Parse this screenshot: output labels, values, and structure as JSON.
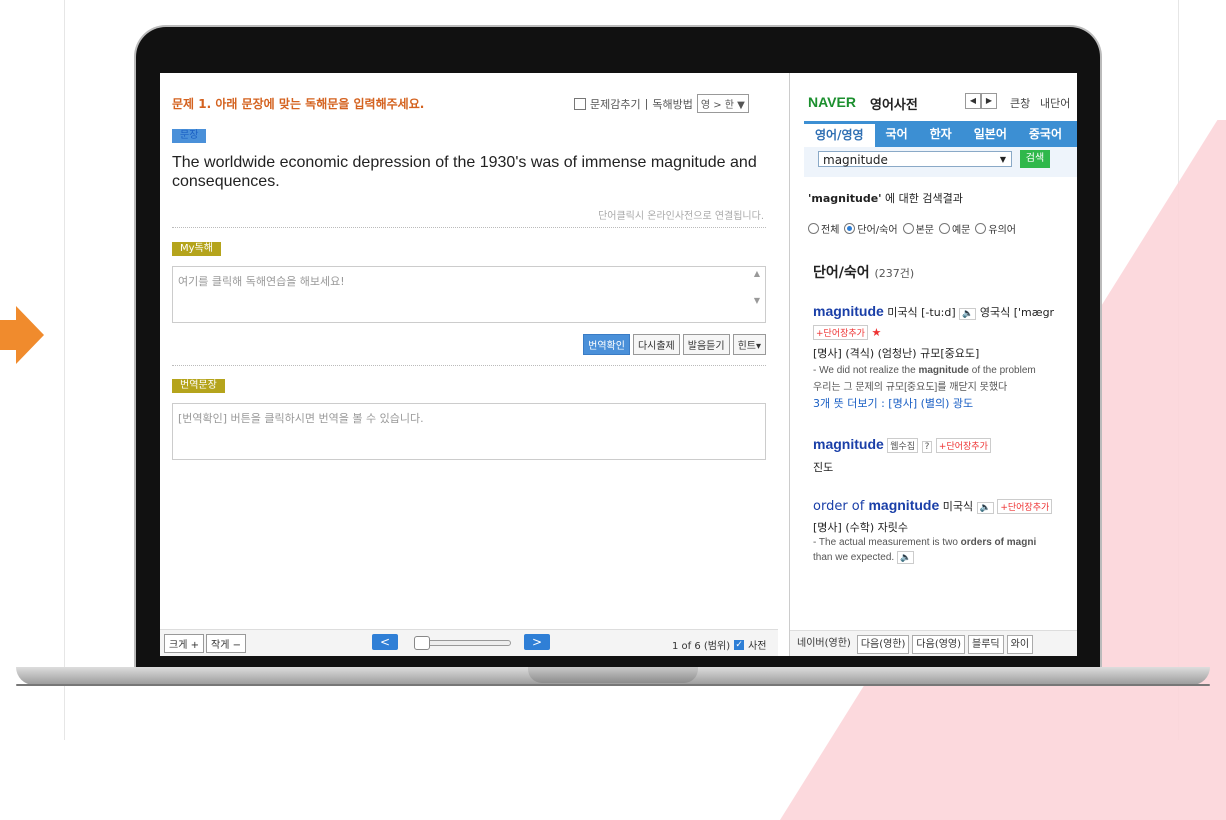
{
  "left": {
    "question": "문제 1. 아래 문장에 맞는 독해문을 입력해주세요.",
    "hide_question": "문제감추기",
    "method_label": "독해방법",
    "method_value": "영 > 한 ▼",
    "sentence_tag": "문장",
    "sentence": "The worldwide economic depression of the 1930's was of immense magnitude and consequences.",
    "click_hint": "단어클릭시 온라인사전으로 연결됩니다.",
    "my_tag": "My독해",
    "my_placeholder": "여기를 클릭해 독해연습을 해보세요!",
    "buttons": [
      "번역확인",
      "다시출제",
      "발음듣기",
      "힌트▾"
    ],
    "trans_tag": "번역문장",
    "trans_placeholder": "[번역확인] 버튼을 클릭하시면 번역을 볼 수 있습니다.",
    "bigger": "크게 +",
    "smaller": "작게 −",
    "prev": "<",
    "next": ">",
    "page_info": "1 of 6 (범위)",
    "dict_label": "사전"
  },
  "right": {
    "logo": "NAVER",
    "title": "영어사전",
    "big_window": "큰창",
    "my_words": "내단어",
    "tabs": [
      "영어/영영",
      "국어",
      "한자",
      "일본어",
      "중국어"
    ],
    "search_value": "magnitude",
    "search_button": "검색",
    "result_term": "'magnitude'",
    "result_suffix": " 에 대한 검색결과",
    "filters": [
      "전체",
      "단어/숙어",
      "본문",
      "예문",
      "유의어"
    ],
    "section": "단어/숙어",
    "section_count": "(237건)",
    "e1_word": "magnitude",
    "e1_us": " 미국식 [-tu:d]",
    "e1_uk": " 영국식 ['mægr",
    "add_word": "+단어장추가",
    "star": "★",
    "e1_pos": "[명사] (격식) ",
    "e1_def": "(엄청난) 규모[중요도]",
    "e1_ex1_pre": "- We did not realize the ",
    "e1_ex1_bold": "magnitude",
    "e1_ex1_post": " of the problem",
    "e1_ex2": "  우리는 그 문제의 규모[중요도]를 깨닫지 못했다",
    "e1_more": "3개 뜻 더보기 : [명사] (별의) 광도",
    "e2_word": "magnitude",
    "e2_badge": "웹수집",
    "e2_q": "?",
    "e2_def": "진도",
    "e3_pre": "order of ",
    "e3_word": "magnitude",
    "e3_us": " 미국식",
    "e3_pos": "[명사] (수학) ",
    "e3_def": "자릿수",
    "e3_ex1_pre": "- The actual measurement is two ",
    "e3_ex1_bold": "orders of magni",
    "e3_ex2": "  than we expected.",
    "dict_tabs": [
      "네이버(영한)",
      "다음(영한)",
      "다음(영영)",
      "블루딕",
      "와이"
    ]
  },
  "colors": {
    "accent_orange": "#f08b2d",
    "naver_green": "#1b8f2e",
    "tab_blue": "#3c8fd3"
  }
}
